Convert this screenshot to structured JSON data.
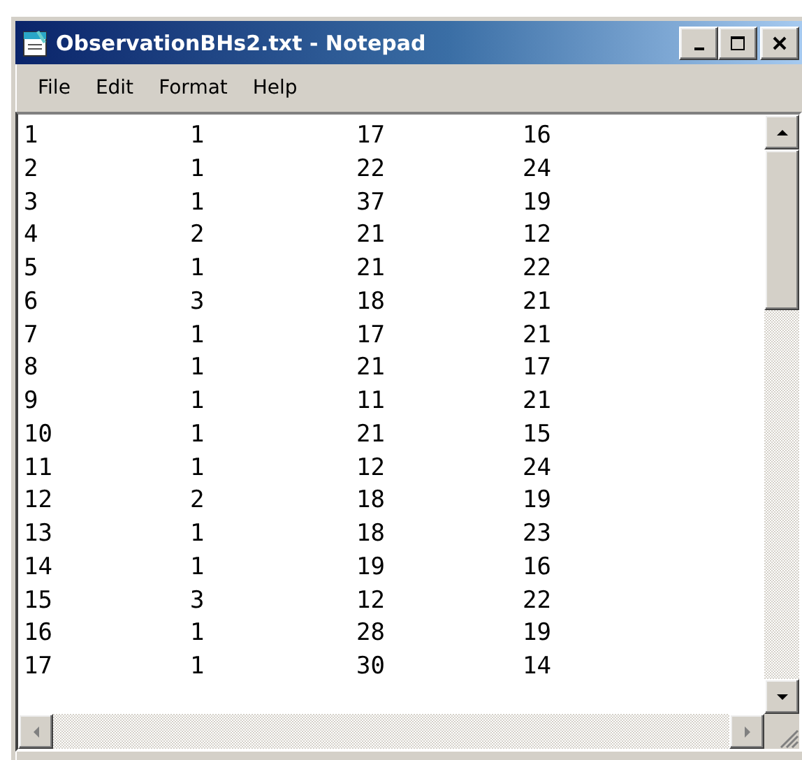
{
  "window": {
    "title": "ObservationBHs2.txt - Notepad"
  },
  "menu": [
    "File",
    "Edit",
    "Format",
    "Help"
  ],
  "document": {
    "lines": [
      "1\t1\t17\t16",
      "2\t1\t22\t24",
      "3\t1\t37\t19",
      "4\t2\t21\t12",
      "5\t1\t21\t22",
      "6\t3\t18\t21",
      "7\t1\t17\t21",
      "8\t1\t21\t17",
      "9\t1\t11\t21",
      "10\t1\t21\t15",
      "11\t1\t12\t24",
      "12\t2\t18\t19",
      "13\t1\t18\t23",
      "14\t1\t19\t16",
      "15\t3\t12\t22",
      "16\t1\t28\t19",
      "17\t1\t30\t14"
    ]
  }
}
